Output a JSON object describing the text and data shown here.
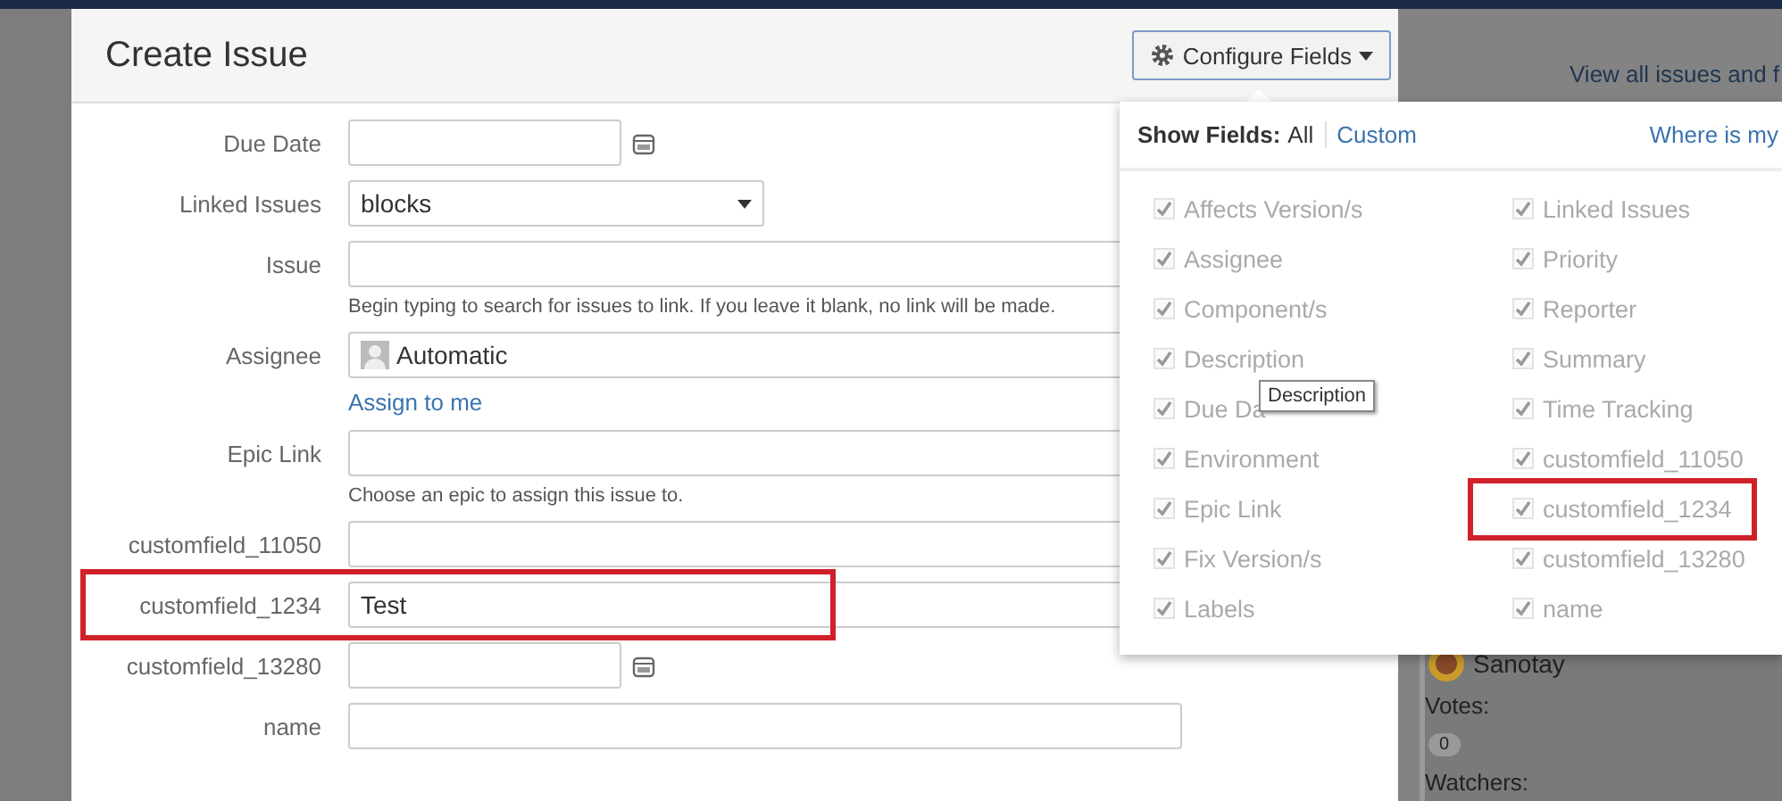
{
  "page": {
    "right_link": "View all issues and f",
    "reporter": "Sanotay",
    "votes_label": "Votes:",
    "votes_count": "0",
    "watchers_label": "Watchers:"
  },
  "dialog": {
    "title": "Create Issue",
    "configure_button": "Configure Fields",
    "fields": [
      {
        "label": "Due Date",
        "kind": "date",
        "highlighted": false
      },
      {
        "label": "Linked Issues",
        "kind": "select",
        "value": "blocks",
        "highlighted": false
      },
      {
        "label": "Issue",
        "kind": "text",
        "help": "Begin typing to search for issues to link. If you leave it blank, no link will be made.",
        "highlighted": false
      },
      {
        "label": "Assignee",
        "kind": "user",
        "value": "Automatic",
        "link": "Assign to me",
        "highlighted": false
      },
      {
        "label": "Epic Link",
        "kind": "text",
        "help": "Choose an epic to assign this issue to.",
        "highlighted": false
      },
      {
        "label": "customfield_11050",
        "kind": "text",
        "highlighted": false
      },
      {
        "label": "customfield_1234",
        "kind": "text",
        "value": "Test",
        "highlighted": true
      },
      {
        "label": "customfield_13280",
        "kind": "date",
        "highlighted": false
      },
      {
        "label": "name",
        "kind": "text",
        "highlighted": false
      }
    ]
  },
  "field_menu": {
    "show_label": "Show Fields:",
    "options": [
      {
        "label": "All",
        "selected": true
      },
      {
        "label": "Custom",
        "selected": false
      }
    ],
    "help_link": "Where is my",
    "left_column": [
      {
        "label": "Affects Version/s",
        "checked": true,
        "highlighted": false
      },
      {
        "label": "Assignee",
        "checked": true,
        "highlighted": false
      },
      {
        "label": "Component/s",
        "checked": true,
        "highlighted": false
      },
      {
        "label": "Description",
        "checked": true,
        "highlighted": false
      },
      {
        "label": "Due Da",
        "checked": true,
        "highlighted": false,
        "tooltip": "Description"
      },
      {
        "label": "Environment",
        "checked": true,
        "highlighted": false
      },
      {
        "label": "Epic Link",
        "checked": true,
        "highlighted": false
      },
      {
        "label": "Fix Version/s",
        "checked": true,
        "highlighted": false
      },
      {
        "label": "Labels",
        "checked": true,
        "highlighted": false
      }
    ],
    "right_column": [
      {
        "label": "Linked Issues",
        "checked": true,
        "highlighted": false
      },
      {
        "label": "Priority",
        "checked": true,
        "highlighted": false
      },
      {
        "label": "Reporter",
        "checked": true,
        "highlighted": false
      },
      {
        "label": "Summary",
        "checked": true,
        "highlighted": false
      },
      {
        "label": "Time Tracking",
        "checked": true,
        "highlighted": false
      },
      {
        "label": "customfield_11050",
        "checked": true,
        "highlighted": false
      },
      {
        "label": "customfield_1234",
        "checked": true,
        "highlighted": true
      },
      {
        "label": "customfield_13280",
        "checked": true,
        "highlighted": false
      },
      {
        "label": "name",
        "checked": true,
        "highlighted": false
      }
    ]
  }
}
